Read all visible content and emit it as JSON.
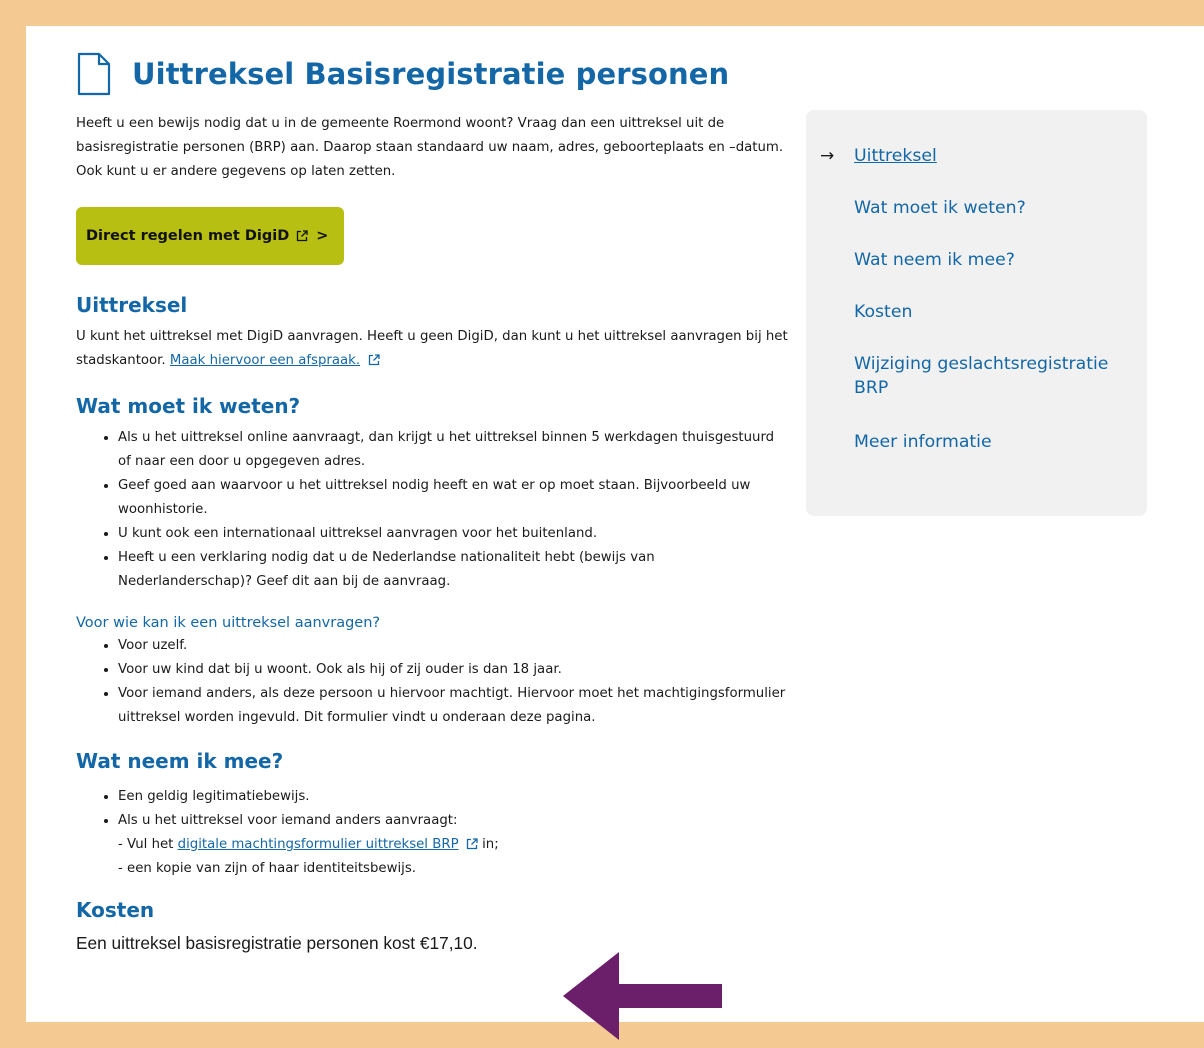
{
  "page": {
    "title": "Uittreksel Basisregistratie personen",
    "intro": "Heeft u een bewijs nodig dat u in de gemeente Roermond woont? Vraag dan een uittreksel uit de basisregistratie personen (BRP) aan. Daarop staan standaard uw naam, adres, geboorteplaats en –datum. Ook kunt u er andere gegevens op laten zetten."
  },
  "cta": {
    "label": "Direct regelen met DigiD",
    "chevron": ">"
  },
  "sections": {
    "uittreksel": {
      "heading": "Uittreksel",
      "text": "U kunt het uittreksel met DigiD aanvragen. Heeft u geen DigiD, dan kunt u het uittreksel aanvragen bij het stadskantoor.",
      "link": "Maak hiervoor een afspraak."
    },
    "weten": {
      "heading": "Wat moet ik weten?",
      "items": [
        "Als u het uittreksel online aanvraagt, dan krijgt u het uittreksel binnen 5 werkdagen thuisgestuurd of naar een door u opgegeven adres.",
        "Geef goed aan waarvoor u het uittreksel nodig heeft en wat er op moet staan. Bijvoorbeeld uw woonhistorie.",
        "U kunt ook een internationaal uittreksel aanvragen voor het buitenland.",
        "Heeft u een verklaring nodig dat u de Nederlandse nationaliteit hebt (bewijs van Nederlanderschap)? Geef dit aan bij de aanvraag."
      ]
    },
    "wie": {
      "heading": "Voor wie kan ik een uittreksel aanvragen?",
      "items": [
        "Voor uzelf.",
        "Voor uw kind dat bij u woont. Ook als hij of zij ouder is dan 18 jaar.",
        "Voor iemand anders, als deze persoon u hiervoor machtigt. Hiervoor moet het machtigingsformulier uittreksel  worden ingevuld. Dit formulier vindt u onderaan deze pagina."
      ]
    },
    "mee": {
      "heading": "Wat neem ik mee?",
      "items": [
        "Een geldig legitimatiebewijs.",
        "Als u het uittreksel voor iemand anders aanvraagt:"
      ],
      "sub1_prefix": "- Vul het",
      "sub1_link": "digitale machtingsformulier uittreksel BRP",
      "sub1_suffix": "in;",
      "sub2": "- een kopie van zijn of haar identiteitsbewijs."
    },
    "kosten": {
      "heading": "Kosten",
      "text": "Een uittreksel basisregistratie personen kost €17,10."
    }
  },
  "sidebar": {
    "arrow": "→",
    "items": [
      "Uittreksel",
      "Wat moet ik weten?",
      "Wat neem ik mee?",
      "Kosten",
      "Wijziging geslachtsregistratie BRP",
      "Meer informatie"
    ]
  },
  "colors": {
    "accent": "#1467a6",
    "cta": "#b6bf12",
    "frame": "#f5c992",
    "annotation_arrow": "#6b1f6b"
  }
}
